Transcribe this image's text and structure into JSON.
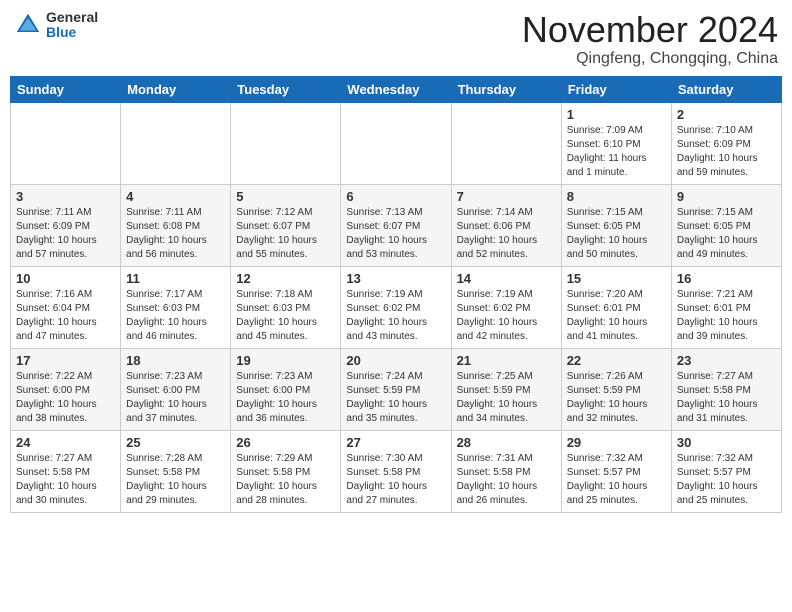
{
  "header": {
    "logo_general": "General",
    "logo_blue": "Blue",
    "month_title": "November 2024",
    "location": "Qingfeng, Chongqing, China"
  },
  "calendar": {
    "weekdays": [
      "Sunday",
      "Monday",
      "Tuesday",
      "Wednesday",
      "Thursday",
      "Friday",
      "Saturday"
    ],
    "weeks": [
      [
        {
          "day": "",
          "info": ""
        },
        {
          "day": "",
          "info": ""
        },
        {
          "day": "",
          "info": ""
        },
        {
          "day": "",
          "info": ""
        },
        {
          "day": "",
          "info": ""
        },
        {
          "day": "1",
          "info": "Sunrise: 7:09 AM\nSunset: 6:10 PM\nDaylight: 11 hours and 1 minute."
        },
        {
          "day": "2",
          "info": "Sunrise: 7:10 AM\nSunset: 6:09 PM\nDaylight: 10 hours and 59 minutes."
        }
      ],
      [
        {
          "day": "3",
          "info": "Sunrise: 7:11 AM\nSunset: 6:09 PM\nDaylight: 10 hours and 57 minutes."
        },
        {
          "day": "4",
          "info": "Sunrise: 7:11 AM\nSunset: 6:08 PM\nDaylight: 10 hours and 56 minutes."
        },
        {
          "day": "5",
          "info": "Sunrise: 7:12 AM\nSunset: 6:07 PM\nDaylight: 10 hours and 55 minutes."
        },
        {
          "day": "6",
          "info": "Sunrise: 7:13 AM\nSunset: 6:07 PM\nDaylight: 10 hours and 53 minutes."
        },
        {
          "day": "7",
          "info": "Sunrise: 7:14 AM\nSunset: 6:06 PM\nDaylight: 10 hours and 52 minutes."
        },
        {
          "day": "8",
          "info": "Sunrise: 7:15 AM\nSunset: 6:05 PM\nDaylight: 10 hours and 50 minutes."
        },
        {
          "day": "9",
          "info": "Sunrise: 7:15 AM\nSunset: 6:05 PM\nDaylight: 10 hours and 49 minutes."
        }
      ],
      [
        {
          "day": "10",
          "info": "Sunrise: 7:16 AM\nSunset: 6:04 PM\nDaylight: 10 hours and 47 minutes."
        },
        {
          "day": "11",
          "info": "Sunrise: 7:17 AM\nSunset: 6:03 PM\nDaylight: 10 hours and 46 minutes."
        },
        {
          "day": "12",
          "info": "Sunrise: 7:18 AM\nSunset: 6:03 PM\nDaylight: 10 hours and 45 minutes."
        },
        {
          "day": "13",
          "info": "Sunrise: 7:19 AM\nSunset: 6:02 PM\nDaylight: 10 hours and 43 minutes."
        },
        {
          "day": "14",
          "info": "Sunrise: 7:19 AM\nSunset: 6:02 PM\nDaylight: 10 hours and 42 minutes."
        },
        {
          "day": "15",
          "info": "Sunrise: 7:20 AM\nSunset: 6:01 PM\nDaylight: 10 hours and 41 minutes."
        },
        {
          "day": "16",
          "info": "Sunrise: 7:21 AM\nSunset: 6:01 PM\nDaylight: 10 hours and 39 minutes."
        }
      ],
      [
        {
          "day": "17",
          "info": "Sunrise: 7:22 AM\nSunset: 6:00 PM\nDaylight: 10 hours and 38 minutes."
        },
        {
          "day": "18",
          "info": "Sunrise: 7:23 AM\nSunset: 6:00 PM\nDaylight: 10 hours and 37 minutes."
        },
        {
          "day": "19",
          "info": "Sunrise: 7:23 AM\nSunset: 6:00 PM\nDaylight: 10 hours and 36 minutes."
        },
        {
          "day": "20",
          "info": "Sunrise: 7:24 AM\nSunset: 5:59 PM\nDaylight: 10 hours and 35 minutes."
        },
        {
          "day": "21",
          "info": "Sunrise: 7:25 AM\nSunset: 5:59 PM\nDaylight: 10 hours and 34 minutes."
        },
        {
          "day": "22",
          "info": "Sunrise: 7:26 AM\nSunset: 5:59 PM\nDaylight: 10 hours and 32 minutes."
        },
        {
          "day": "23",
          "info": "Sunrise: 7:27 AM\nSunset: 5:58 PM\nDaylight: 10 hours and 31 minutes."
        }
      ],
      [
        {
          "day": "24",
          "info": "Sunrise: 7:27 AM\nSunset: 5:58 PM\nDaylight: 10 hours and 30 minutes."
        },
        {
          "day": "25",
          "info": "Sunrise: 7:28 AM\nSunset: 5:58 PM\nDaylight: 10 hours and 29 minutes."
        },
        {
          "day": "26",
          "info": "Sunrise: 7:29 AM\nSunset: 5:58 PM\nDaylight: 10 hours and 28 minutes."
        },
        {
          "day": "27",
          "info": "Sunrise: 7:30 AM\nSunset: 5:58 PM\nDaylight: 10 hours and 27 minutes."
        },
        {
          "day": "28",
          "info": "Sunrise: 7:31 AM\nSunset: 5:58 PM\nDaylight: 10 hours and 26 minutes."
        },
        {
          "day": "29",
          "info": "Sunrise: 7:32 AM\nSunset: 5:57 PM\nDaylight: 10 hours and 25 minutes."
        },
        {
          "day": "30",
          "info": "Sunrise: 7:32 AM\nSunset: 5:57 PM\nDaylight: 10 hours and 25 minutes."
        }
      ]
    ]
  }
}
